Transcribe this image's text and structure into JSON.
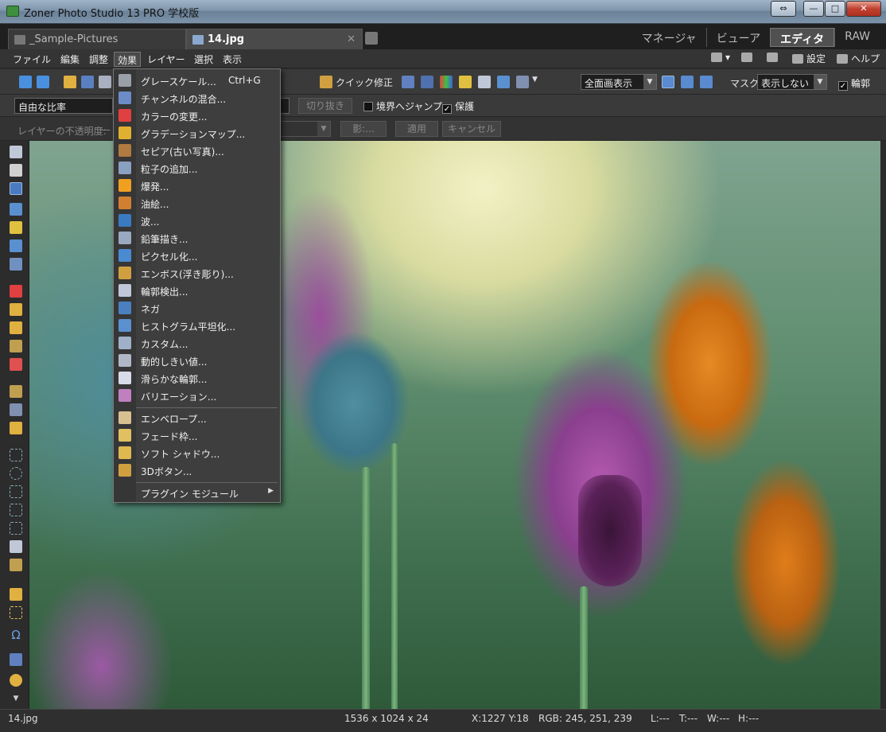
{
  "window": {
    "title": "Zoner Photo Studio 13 PRO 学校版",
    "controls": [
      "⇔",
      "—",
      "□",
      "✕"
    ]
  },
  "tabs": {
    "docs": [
      {
        "label": "_Sample-Pictures",
        "active": false
      },
      {
        "label": "14.jpg",
        "active": true,
        "close": "✕"
      }
    ],
    "modes": [
      "マネージャ",
      "ビューア",
      "エディタ",
      "RAW"
    ]
  },
  "menu": {
    "items": [
      "ファイル",
      "編集",
      "調整",
      "効果",
      "レイヤー",
      "選択",
      "表示"
    ],
    "right": {
      "settings": "設定",
      "help": "ヘルプ"
    }
  },
  "toolbar1": {
    "quick_fix": "クイック修正",
    "view_combo": "全面画表示",
    "mask_label": "マスク:",
    "mask_combo": "表示しない",
    "outline_check": "輪郭"
  },
  "toolbar2": {
    "ratio_combo": "自由な比率",
    "crop_button": "切り抜き",
    "jump_check": "境界へジャンプ",
    "protect_check": "保護"
  },
  "toolbar3": {
    "layer_opacity": "レイヤーの不透明度:",
    "shadow_button": "影:...",
    "apply_button": "適用",
    "cancel_button": "キャンセル"
  },
  "effects_menu": {
    "groups": [
      [
        {
          "label": "グレースケール...",
          "shortcut": "Ctrl+G",
          "icon": "grayscale-icon",
          "color": "#9aa0a8"
        },
        {
          "label": "チャンネルの混合...",
          "icon": "channel-mixer-icon",
          "color": "#6c8cc8"
        },
        {
          "label": "カラーの変更...",
          "icon": "color-change-icon",
          "color": "#e04040"
        },
        {
          "label": "グラデーションマップ...",
          "icon": "gradient-map-icon",
          "color": "#e0b030"
        },
        {
          "label": "セピア(古い写真)...",
          "icon": "sepia-icon",
          "color": "#b07a40"
        },
        {
          "label": "粒子の追加...",
          "icon": "grain-icon",
          "color": "#8aa0c0"
        },
        {
          "label": "爆発...",
          "icon": "explosion-icon",
          "color": "#f0a020"
        },
        {
          "label": "油絵...",
          "icon": "oil-paint-icon",
          "color": "#d08030"
        },
        {
          "label": "波...",
          "icon": "wave-icon",
          "color": "#3a7ac0"
        },
        {
          "label": "鉛筆描き...",
          "icon": "pencil-sketch-icon",
          "color": "#9aa8c0"
        },
        {
          "label": "ピクセル化...",
          "icon": "pixelate-icon",
          "color": "#4a8ad0"
        },
        {
          "label": "エンボス(浮き彫り)...",
          "icon": "emboss-icon",
          "color": "#d0a040"
        },
        {
          "label": "輪郭検出...",
          "icon": "edge-detect-icon",
          "color": "#c0c8d8"
        },
        {
          "label": "ネガ",
          "icon": "negative-icon",
          "color": "#4a80c0"
        },
        {
          "label": "ヒストグラム平坦化...",
          "icon": "histogram-equalize-icon",
          "color": "#5a90d0"
        },
        {
          "label": "カスタム...",
          "icon": "custom-filter-icon",
          "color": "#a0b0c8"
        },
        {
          "label": "動的しきい値...",
          "icon": "dynamic-threshold-icon",
          "color": "#b0b8c8"
        },
        {
          "label": "滑らかな輪郭...",
          "icon": "smooth-edge-icon",
          "color": "#d8dce8"
        },
        {
          "label": "バリエーション...",
          "icon": "variations-icon",
          "color": "#c080c0"
        }
      ],
      [
        {
          "label": "エンベロープ...",
          "icon": "envelope-icon",
          "color": "#d8c090"
        },
        {
          "label": "フェード枠...",
          "icon": "fade-frame-icon",
          "color": "#e0c060"
        },
        {
          "label": "ソフト シャドウ...",
          "icon": "soft-shadow-icon",
          "color": "#e0b850"
        },
        {
          "label": "3Dボタン...",
          "icon": "3d-button-icon",
          "color": "#d0a040"
        }
      ],
      [
        {
          "label": "プラグイン モジュール",
          "submenu": "▶"
        }
      ]
    ]
  },
  "statusbar": {
    "filename": "14.jpg",
    "dimensions": "1536 x 1024 x 24",
    "coords": "X:1227 Y:18",
    "rgb": "RGB: 245, 251, 239",
    "l": "L:---",
    "t": "T:---",
    "w": "W:---",
    "h": "H:---"
  }
}
